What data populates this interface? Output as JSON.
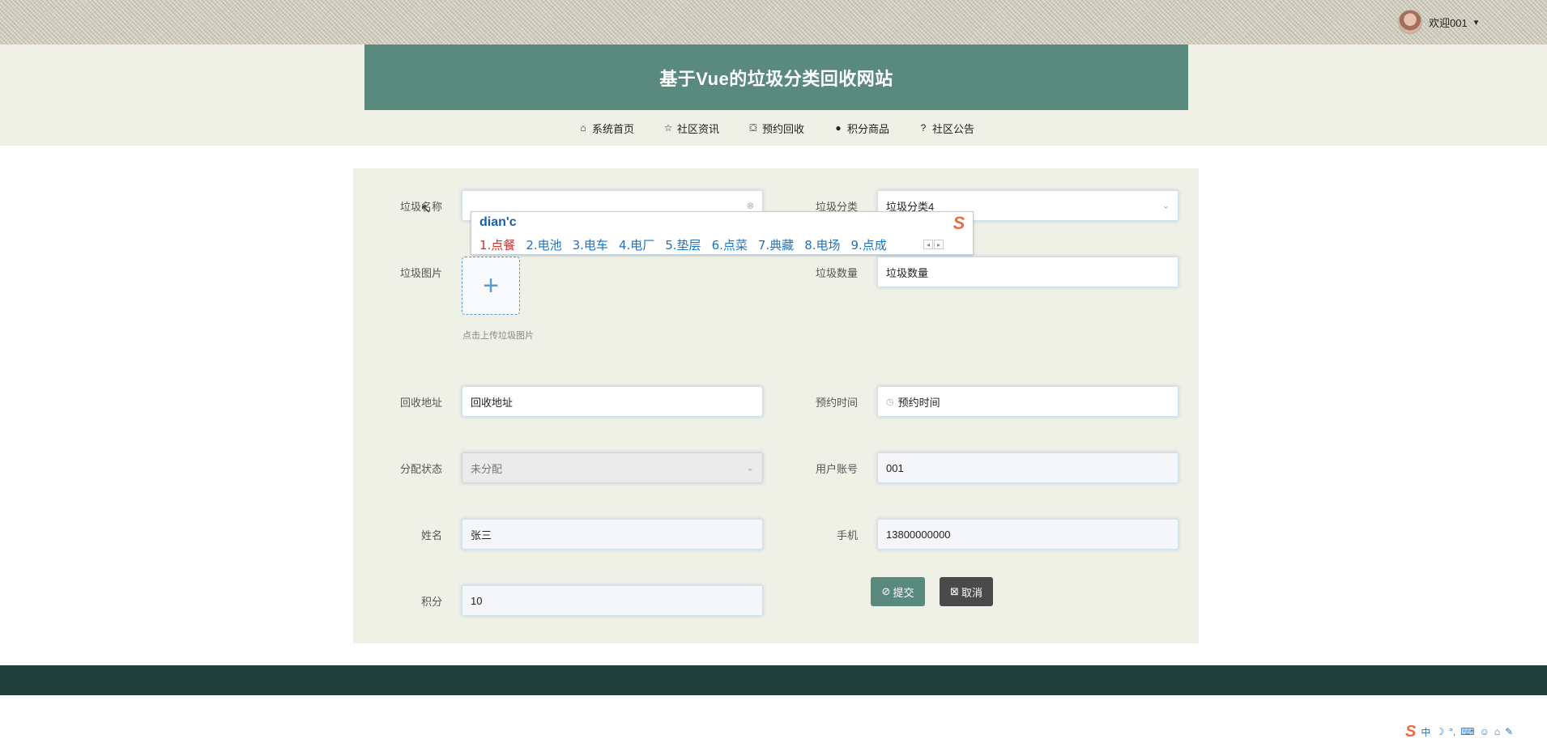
{
  "user": {
    "welcome": "欢迎001",
    "caret": "▾"
  },
  "site": {
    "title": "基于Vue的垃圾分类回收网站"
  },
  "nav": [
    {
      "label": "系统首页",
      "icon": "home-icon",
      "glyph": "⌂"
    },
    {
      "label": "社区资讯",
      "icon": "star-icon",
      "glyph": "☆"
    },
    {
      "label": "预约回收",
      "icon": "bag-icon",
      "glyph": "⛋"
    },
    {
      "label": "积分商品",
      "icon": "info-icon",
      "glyph": "●"
    },
    {
      "label": "社区公告",
      "icon": "question-icon",
      "glyph": "?"
    }
  ],
  "form": {
    "name": {
      "label": "垃圾名称",
      "value": ""
    },
    "category": {
      "label": "垃圾分类",
      "value": "垃圾分类4"
    },
    "image": {
      "label": "垃圾图片",
      "tip": "点击上传垃圾图片",
      "plus": "+"
    },
    "quantity": {
      "label": "垃圾数量",
      "placeholder": "垃圾数量"
    },
    "address": {
      "label": "回收地址",
      "placeholder": "回收地址"
    },
    "time": {
      "label": "预约时间",
      "placeholder": "预约时间"
    },
    "status": {
      "label": "分配状态",
      "value": "未分配"
    },
    "account": {
      "label": "用户账号",
      "value": "001"
    },
    "realname": {
      "label": "姓名",
      "value": "张三"
    },
    "phone": {
      "label": "手机",
      "value": "13800000000"
    },
    "points": {
      "label": "积分",
      "value": "10"
    }
  },
  "buttons": {
    "submit": "提交",
    "cancel": "取消"
  },
  "ime": {
    "input": "dian'c",
    "candidates": [
      "1.点餐",
      "2.电池",
      "3.电车",
      "4.电厂",
      "5.垫层",
      "6.点菜",
      "7.典藏",
      "8.电场",
      "9.点成"
    ],
    "logo": "S",
    "prev": "◂",
    "next": "▸"
  },
  "tray": {
    "logo": "S",
    "lang": "中",
    "moon": "☽",
    "punct": "°,",
    "keyboard": "⌨",
    "person": "☺",
    "shirt": "⌂",
    "tool": "✎"
  }
}
